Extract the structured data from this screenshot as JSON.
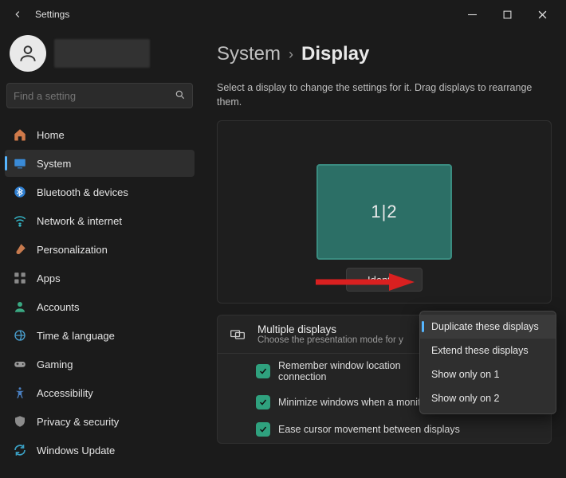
{
  "window": {
    "title": "Settings"
  },
  "search": {
    "placeholder": "Find a setting"
  },
  "sidebar": {
    "items": [
      {
        "label": "Home"
      },
      {
        "label": "System"
      },
      {
        "label": "Bluetooth & devices"
      },
      {
        "label": "Network & internet"
      },
      {
        "label": "Personalization"
      },
      {
        "label": "Apps"
      },
      {
        "label": "Accounts"
      },
      {
        "label": "Time & language"
      },
      {
        "label": "Gaming"
      },
      {
        "label": "Accessibility"
      },
      {
        "label": "Privacy & security"
      },
      {
        "label": "Windows Update"
      }
    ]
  },
  "breadcrumb": {
    "parent": "System",
    "sep": "›",
    "current": "Display"
  },
  "description": "Select a display to change the settings for it. Drag displays to rearrange them.",
  "monitor_label": "1|2",
  "identify_label": "Identify",
  "dropdown": {
    "items": [
      {
        "label": "Duplicate these displays"
      },
      {
        "label": "Extend these displays"
      },
      {
        "label": "Show only on 1"
      },
      {
        "label": "Show only on 2"
      }
    ]
  },
  "multi_displays": {
    "title": "Multiple displays",
    "sub": "Choose the presentation mode for y",
    "check1": "Remember window locations based on monitor connection",
    "check1_vis": "Remember window location",
    "check1_vis2": "connection",
    "check2": "Minimize windows when a monitor is disconnected",
    "check3": "Ease cursor movement between displays"
  },
  "icons": {
    "home": "home-icon",
    "system": "system-icon",
    "bt": "bluetooth-icon",
    "net": "wifi-icon",
    "pers": "brush-icon",
    "apps": "apps-icon",
    "acct": "person-icon",
    "time": "globe-clock-icon",
    "game": "gamepad-icon",
    "a11y": "accessibility-icon",
    "priv": "shield-icon",
    "wu": "update-icon"
  }
}
